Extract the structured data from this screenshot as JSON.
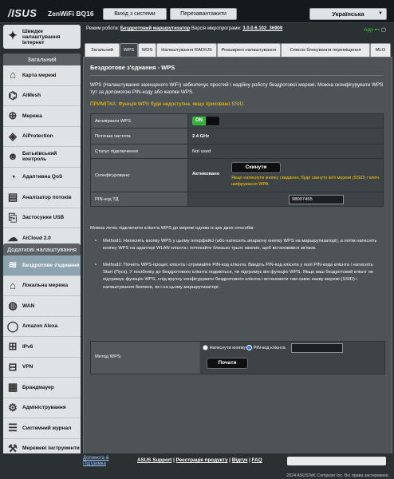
{
  "header": {
    "logo": "/ISUS",
    "model": "ZenWiFi BQ16",
    "logout_label": "Вихід з системи",
    "reboot_label": "Перезавантажити",
    "language": "Українська"
  },
  "status": {
    "mode_label": "Режим роботи:",
    "mode_value": "Бездротовий маршрутизатор",
    "fw_label": "Версія мікропрограми:",
    "fw_value": "3.0.0.6.102_36909",
    "app_label": "App",
    "extra": "SSID:"
  },
  "sidebar": {
    "quick_label": "Швидке налаштування Інтернет",
    "general_header": "Загальний",
    "general_items": [
      {
        "label": "Карта мережі",
        "icon": "map-icon"
      },
      {
        "label": "AiMesh",
        "icon": "mesh-icon"
      },
      {
        "label": "Мережа",
        "icon": "network-icon"
      },
      {
        "label": "AiProtection",
        "icon": "shield-icon"
      },
      {
        "label": "Батьківський контроль",
        "icon": "parental-icon"
      },
      {
        "label": "Адаптивна QoS",
        "icon": "qos-icon"
      },
      {
        "label": "Аналізатор потоків",
        "icon": "analyzer-icon"
      },
      {
        "label": "Застосунки USB",
        "icon": "usb-icon"
      },
      {
        "label": "AiCloud 2.0",
        "icon": "cloud-icon"
      }
    ],
    "advanced_header": "Додаткові налаштування",
    "advanced_items": [
      {
        "label": "Бездротове з'єднання",
        "icon": "wireless-icon"
      },
      {
        "label": "Локальна мережа",
        "icon": "lan-icon"
      },
      {
        "label": "WAN",
        "icon": "wan-icon"
      },
      {
        "label": "Amazon Alexa",
        "icon": "alexa-icon"
      },
      {
        "label": "IPv6",
        "icon": "ipv6-icon"
      },
      {
        "label": "VPN",
        "icon": "vpn-icon"
      },
      {
        "label": "Брандмауер",
        "icon": "firewall-icon"
      },
      {
        "label": "Адміністрування",
        "icon": "admin-icon"
      },
      {
        "label": "Системний журнал",
        "icon": "log-icon"
      },
      {
        "label": "Мережеві інструменти",
        "icon": "tools-icon"
      }
    ]
  },
  "tabs": [
    "Загальний",
    "WPS",
    "WDS",
    "Налаштування RADIUS",
    "Розширені налаштування",
    "Список блокування переміщення",
    "MLO"
  ],
  "panel": {
    "title": "Бездротове з'єднання - WPS",
    "description": "WPS (Налаштування захищеного WiFi) забезпечує простий і надійну роботу бездротової мережі. Можна сконфігурувати WPS тут за допомогою PIN-коду або кнопки WPS.",
    "note": "ПРИМІТКА: Функція WPS буде недоступна, якщо приховано SSID.",
    "rows": {
      "enable_label": "Активувати WPS",
      "enable_value": "ON",
      "freq_label": "Поточна частота",
      "freq_value": "2.4 GHz",
      "conn_label": "Статус підключення",
      "conn_value": "Not used",
      "conf_label": "Сконфігуровано",
      "conf_value": "Активовано",
      "reset_label": "Скинути",
      "conf_hint": "Якщо натиснути кнопку скидання, буде скинуто ім'я мережі (SSID) і ключ шифрування WPA.",
      "pin_label": "PIN-код ТД",
      "pin_value": "98007455"
    },
    "methods_intro": "Можна легко підключити клієнта WPS до мережі одним із цих двох способів:",
    "method1": "Method1: Натисніть кнопку WPS у цьому інтерфейсі (або натисніть апаратну кнопку WPS на маршрутизаторі), а потім натисніть кнопку WPS на адаптері WLAN клієнта і почекайте близько трьох хвилин, щоб встановився зв'язок.",
    "method2": "Method2: Почніть WPS-процес клієнта і отримайте PIN-код клієнта. Введіть PIN-код клієнта у полі PIN-кода клієнта і натисніть Start (Пуск). У посібнику до бездротового клієнта подивіться, чи підтримує він функцію WPS. Якщо ваш бездротовий клієнт не підтримує функцію WPS, слід вручну конфігурувати бездротового клієнта і встановити там самю назву мережі (SSID) і налаштування безпеки, як і на цьому маршрутизаторі.",
    "wps_method_label": "Метод WPS:",
    "opt_push": "Натиснути кнопку",
    "opt_pin": "PIN-код клієнта",
    "start_label": "Почати"
  },
  "footer": {
    "help": "Допомога & Підтримка",
    "links": [
      "ASUS Support",
      "Реєстрація продукту",
      "Відгук",
      "FAQ"
    ],
    "copyright": "2024 ASUSTeK Computer Inc. Всі права застережені."
  },
  "colors": {
    "accent": "#33b538",
    "warning": "#ffcc00",
    "panel": "#4d5356"
  }
}
